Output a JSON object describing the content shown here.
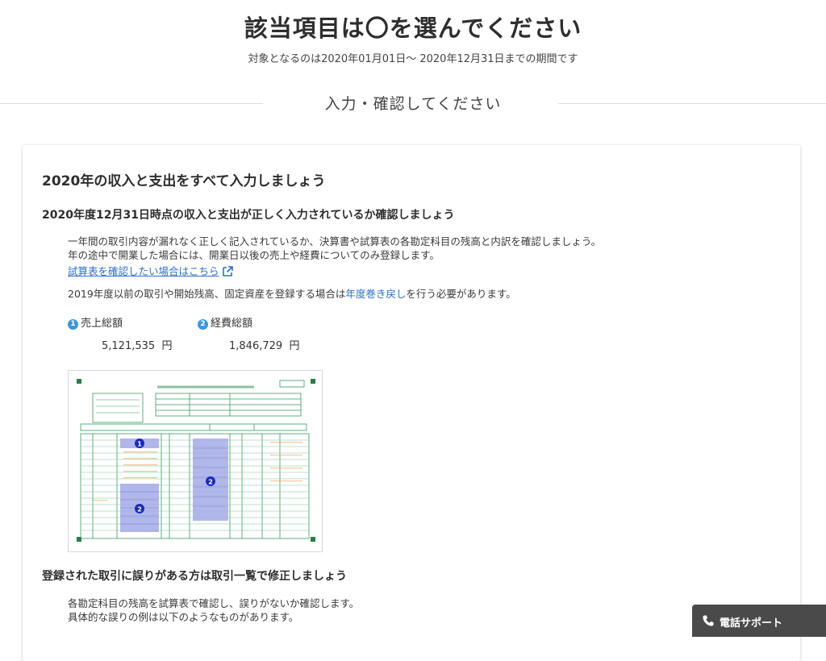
{
  "header": {
    "title": "該当項目は〇を選んでください",
    "subtitle": "対象となるのは2020年01月01日〜 2020年12月31日までの期間です"
  },
  "section": {
    "heading": "入力・確認してください"
  },
  "card": {
    "title": "2020年の収入と支出をすべて入力しましょう",
    "subheading1": "2020年度12月31日時点の収入と支出が正しく入力されているか確認しましょう",
    "para1_line1": "一年間の取引内容が漏れなく正しく記入されているか、決算書や試算表の各勘定科目の残高と内訳を確認しましょう。",
    "para1_line2": "年の途中で開業した場合には、開業日以後の売上や経費についてのみ登録します。",
    "trial_balance_link": "試算表を確認したい場合はこちら",
    "para2_before": "2019年度以前の取引や開始残高、固定資産を登録する場合は",
    "para2_link": "年度巻き戻し",
    "para2_after": "を行う必要があります。",
    "metrics": [
      {
        "badge": "1",
        "label": "売上総額",
        "value": "5,121,535",
        "unit": "円"
      },
      {
        "badge": "2",
        "label": "経費総額",
        "value": "1,846,729",
        "unit": "円"
      }
    ],
    "subheading2": "登録された取引に誤りがある方は取引一覧で修正しましょう",
    "para3_line1": "各勘定科目の残高を試算表で確認し、誤りがないか確認します。",
    "para3_line2": "具体的な誤りの例は以下のようなものがあります。"
  },
  "form_image": {
    "badge1": "1",
    "badge2": "2"
  },
  "support": {
    "label": "電話サポート"
  },
  "colors": {
    "accent_link": "#2f6fc9",
    "badge_blue": "#3d97d9",
    "form_green": "#3a9a5c",
    "form_highlight": "#9fa6e6",
    "support_bg": "#4a4a4a"
  }
}
